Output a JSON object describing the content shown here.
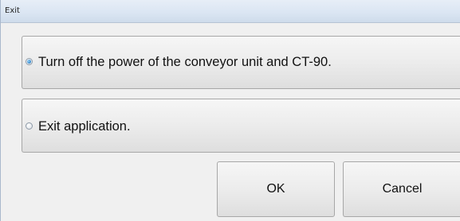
{
  "window": {
    "title": "Exit"
  },
  "options": [
    {
      "label": "Turn off the power of the conveyor unit and CT-90.",
      "selected": true
    },
    {
      "label": "Exit application.",
      "selected": false
    }
  ],
  "buttons": {
    "ok_label": "OK",
    "cancel_label": "Cancel"
  },
  "colors": {
    "titlebar": "#dbe6f3",
    "dialog_background": "#f0f0f0",
    "radio_selected": "#3d8fd1"
  }
}
